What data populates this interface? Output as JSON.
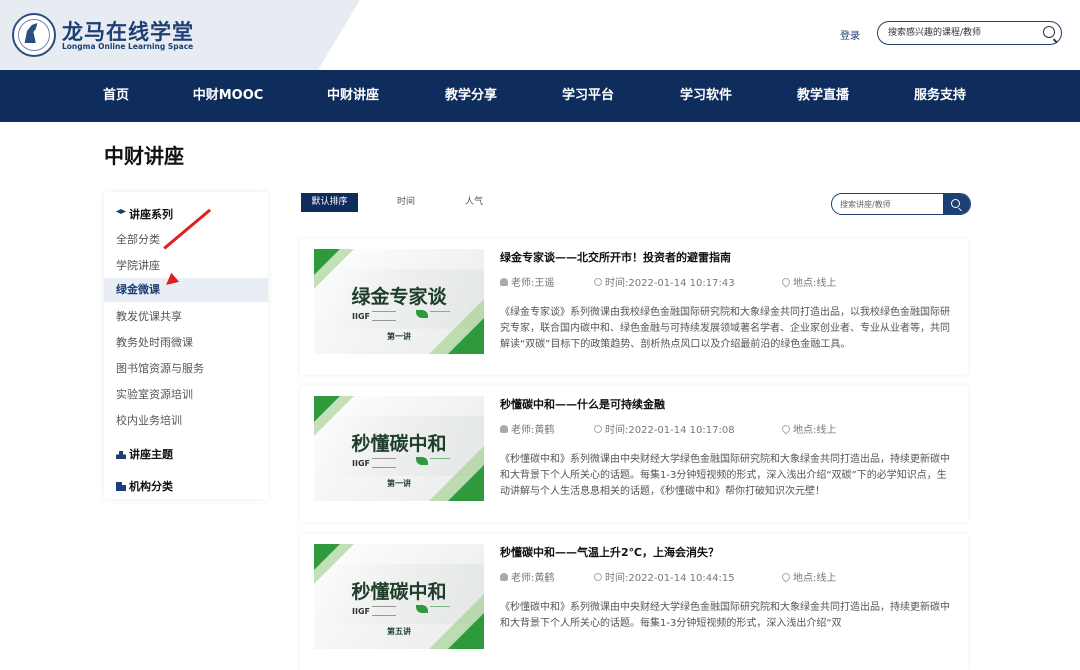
{
  "header": {
    "logo_title": "龙马在线学堂",
    "logo_subtitle": "Longma Online Learning Space",
    "login_label": "登录",
    "search_placeholder": "搜索感兴趣的课程/教师"
  },
  "nav": {
    "items": [
      {
        "label": "首页"
      },
      {
        "label": "中财MOOC"
      },
      {
        "label": "中财讲座"
      },
      {
        "label": "教学分享"
      },
      {
        "label": "学习平台"
      },
      {
        "label": "学习软件"
      },
      {
        "label": "教学直播"
      },
      {
        "label": "服务支持"
      }
    ]
  },
  "page": {
    "title": "中财讲座"
  },
  "sidebar": {
    "series_heading": "讲座系列",
    "items": [
      {
        "label": "全部分类"
      },
      {
        "label": "学院讲座"
      },
      {
        "label": "绿金微课",
        "active": true
      },
      {
        "label": "教发优课共享"
      },
      {
        "label": "教务处时雨微课"
      },
      {
        "label": "图书馆资源与服务"
      },
      {
        "label": "实验室资源培训"
      },
      {
        "label": "校内业务培训"
      }
    ],
    "topic_heading": "讲座主题",
    "org_heading": "机构分类"
  },
  "sort": {
    "default_label": "默认排序",
    "time_label": "时间",
    "popularity_label": "人气",
    "search_placeholder": "搜索讲座/教师"
  },
  "lectures": [
    {
      "thumb_title": "绿金专家谈",
      "thumb_lesson": "第一讲",
      "thumb_brand": "IIGF",
      "title": "绿金专家谈——北交所开市！投资者的避雷指南",
      "teacher": "老师:王遥",
      "time": "时间:2022-01-14 10:17:43",
      "location": "地点:线上",
      "description": "《绿金专家谈》系列微课由我校绿色金融国际研究院和大象绿金共同打造出品，以我校绿色金融国际研究专家，联合国内碳中和、绿色金融与可持续发展领域著名学者、企业家创业者、专业从业者等，共同解读“双碳”目标下的政策趋势、剖析热点风口以及介绍最前沿的绿色金融工具。"
    },
    {
      "thumb_title": "秒懂碳中和",
      "thumb_lesson": "第一讲",
      "thumb_brand": "IIGF",
      "title": "秒懂碳中和——什么是可持续金融",
      "teacher": "老师:黄鹤",
      "time": "时间:2022-01-14 10:17:08",
      "location": "地点:线上",
      "description": "《秒懂碳中和》系列微课由中央财经大学绿色金融国际研究院和大象绿金共同打造出品，持续更新碳中和大背景下个人所关心的话题。每集1-3分钟短视频的形式，深入浅出介绍“双碳”下的必学知识点，生动讲解与个人生活息息相关的话题，《秒懂碳中和》帮你打破知识次元壁！"
    },
    {
      "thumb_title": "秒懂碳中和",
      "thumb_lesson": "第五讲",
      "thumb_brand": "IIGF",
      "title": "秒懂碳中和——气温上升2℃，上海会消失？",
      "teacher": "老师:黄鹤",
      "time": "时间:2022-01-14 10:44:15",
      "location": "地点:线上",
      "description": "《秒懂碳中和》系列微课由中央财经大学绿色金融国际研究院和大象绿金共同打造出品，持续更新碳中和大背景下个人所关心的话题。每集1-3分钟短视频的形式，深入浅出介绍“双"
    }
  ],
  "colors": {
    "primary": "#0e2c5c",
    "accent_green": "#2f9a3c",
    "annotation_arrow": "#e02020"
  }
}
